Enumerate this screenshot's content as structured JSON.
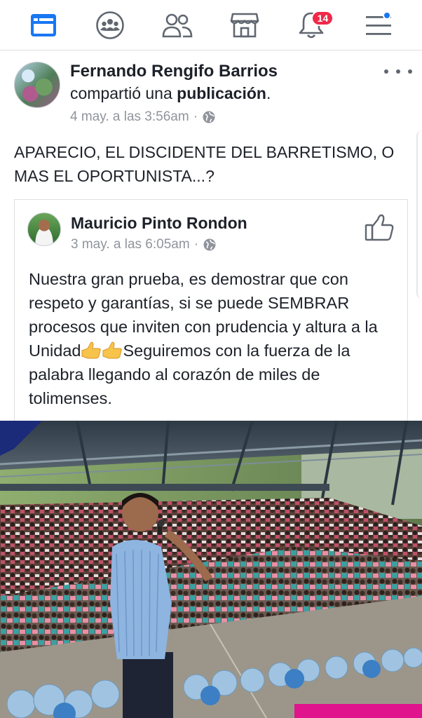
{
  "nav": {
    "badge_count": "14",
    "items": [
      {
        "name": "news-feed",
        "icon": "news-feed-icon"
      },
      {
        "name": "groups",
        "icon": "groups-icon"
      },
      {
        "name": "friends",
        "icon": "friends-icon"
      },
      {
        "name": "marketplace",
        "icon": "marketplace-icon"
      },
      {
        "name": "notifications",
        "icon": "bell-icon"
      },
      {
        "name": "menu",
        "icon": "hamburger-icon"
      }
    ],
    "accent": "#1877f2",
    "badge_color": "#f02849"
  },
  "post": {
    "author": "Fernando Rengifo Barrios",
    "shared_prefix": "compartió una ",
    "shared_object": "publicación",
    "shared_suffix": ".",
    "timestamp": "4 may. a las 3:56am",
    "separator": "·",
    "privacy_icon": "globe-icon",
    "text": "APARECIO, EL DISCIDENTE DEL BARRETISMO, O MAS EL OPORTUNISTA...?"
  },
  "shared_post": {
    "author": "Mauricio Pinto Rondon",
    "timestamp": "3 may. a las 6:05am",
    "separator": "·",
    "privacy_icon": "globe-icon",
    "like_icon": "thumbs-up-icon",
    "text_part1": "Nuestra gran prueba, es demostrar que con respeto y garantías, si se puede SEMBRAR procesos que inviten con prudencia y altura a la Unidad",
    "emoji": "thumbs-up-emoji",
    "text_part2": "Seguiremos con la fuerza de la palabra llegando al corazón de miles de tolimenses."
  },
  "photo": {
    "description_icon": "photo-image"
  }
}
